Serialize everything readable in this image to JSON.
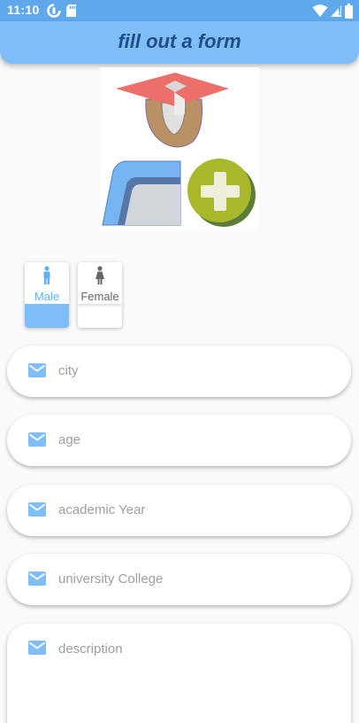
{
  "status_bar": {
    "time": "11:10",
    "left_icons": [
      "data-saver-icon",
      "sd-card-icon"
    ],
    "right_icons": [
      "wifi-icon",
      "signal-icon",
      "battery-icon"
    ],
    "color": "#5fa8ec"
  },
  "app_bar": {
    "title": "fill out a form",
    "color": "#7fbdfb"
  },
  "logo": {
    "icons": [
      "graduation-cap-icon",
      "folder-icon",
      "plus-icon"
    ]
  },
  "gender": {
    "options": [
      {
        "label": "Male",
        "icon": "male-icon",
        "selected": true
      },
      {
        "label": "Female",
        "icon": "female-icon",
        "selected": false
      }
    ],
    "selected_color": "#7fbdfb"
  },
  "form": {
    "fields": [
      {
        "placeholder": "city",
        "icon": "mail-icon"
      },
      {
        "placeholder": "age",
        "icon": "mail-icon"
      },
      {
        "placeholder": "academic Year",
        "icon": "mail-icon"
      },
      {
        "placeholder": "university College",
        "icon": "mail-icon"
      },
      {
        "placeholder": "description",
        "icon": "mail-icon"
      }
    ],
    "icon_color": "#7fbdfb"
  }
}
